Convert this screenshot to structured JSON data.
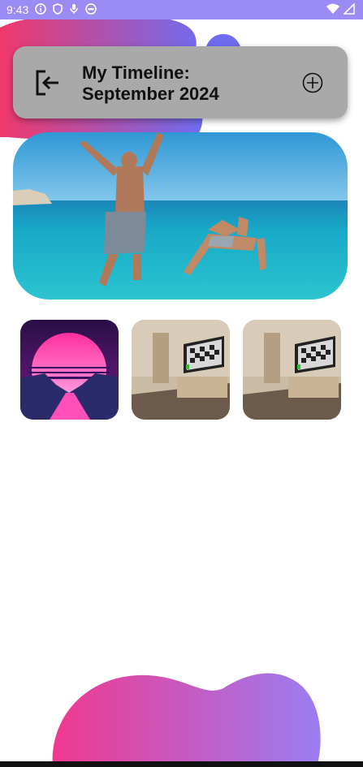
{
  "status_bar": {
    "time": "9:43",
    "icons": [
      "info-icon",
      "shield-icon",
      "mic-icon",
      "sync-icon",
      "wifi-icon",
      "signal-icon"
    ]
  },
  "header": {
    "title": "My Timeline:\nSeptember 2024",
    "exit_icon": "exit-icon",
    "add_icon": "add-circle-icon",
    "background": "#a9a9a9"
  },
  "hero_image": {
    "description_icon": "photo"
  },
  "gallery": {
    "items": [
      {
        "name": "synthwave-sunset-image"
      },
      {
        "name": "room-tv-image-1"
      },
      {
        "name": "room-tv-image-2"
      }
    ]
  },
  "colors": {
    "accent": "#9b8cf5",
    "blob_start": "#f0386b",
    "blob_end": "#8a7cf5"
  }
}
